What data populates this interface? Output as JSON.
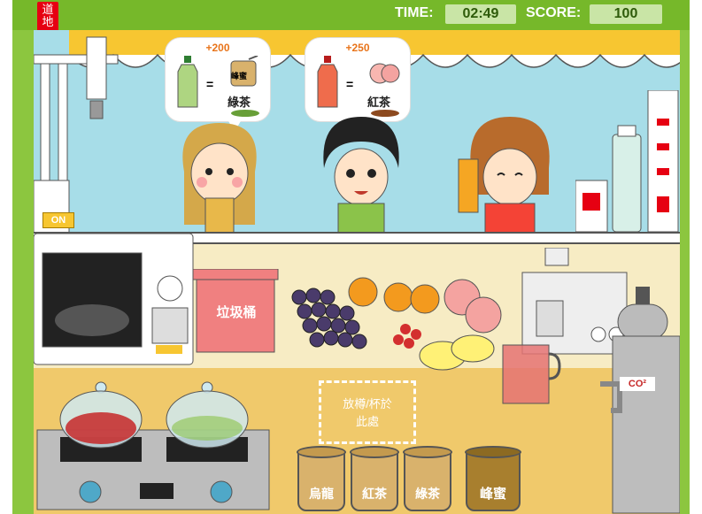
{
  "hud": {
    "time_label": "TIME:",
    "time_value": "02:49",
    "score_label": "SCORE:",
    "score_value": "100"
  },
  "logo_text": "道地",
  "orders": [
    {
      "points": "+200",
      "ingredient": "峰蜜",
      "result": "綠茶",
      "equals": "="
    },
    {
      "points": "+250",
      "ingredient": "peach",
      "result": "紅茶",
      "equals": "="
    }
  ],
  "machine": {
    "power_label": "ON"
  },
  "trash": {
    "label": "垃圾桶"
  },
  "dropzone": {
    "label_line1": "放樽/杯於",
    "label_line2": "此處"
  },
  "jars": [
    {
      "label": "烏龍"
    },
    {
      "label": "紅茶"
    },
    {
      "label": "綠茶"
    },
    {
      "label": "峰蜜"
    }
  ],
  "co2_label": "CO²",
  "colors": {
    "frame_green": "#76b82a",
    "accent_orange": "#e8741a",
    "trash_pink": "#f08080",
    "brand_red": "#e60012"
  }
}
